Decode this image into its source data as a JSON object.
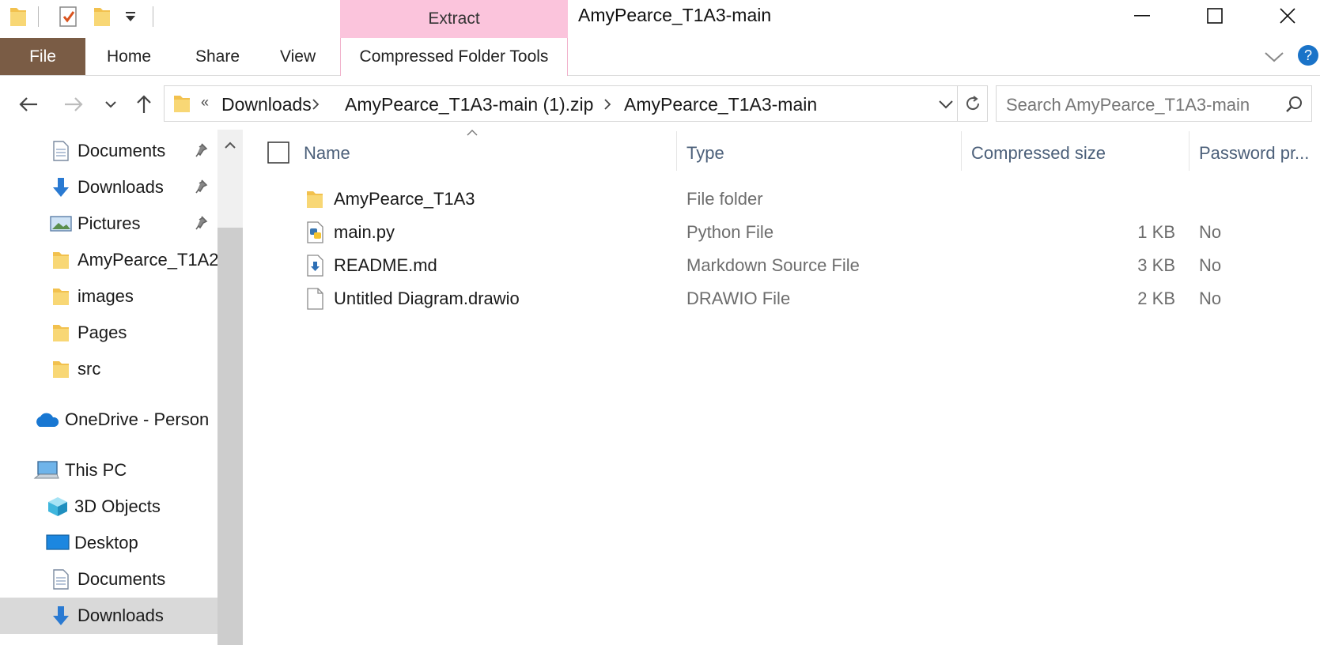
{
  "window": {
    "title": "AmyPearce_T1A3-main",
    "context_group": "Extract"
  },
  "ribbon": {
    "tabs": [
      "File",
      "Home",
      "Share",
      "View",
      "Compressed Folder Tools"
    ]
  },
  "address": {
    "overflow": "«",
    "crumbs": [
      "Downloads",
      "AmyPearce_T1A3-main (1).zip",
      "AmyPearce_T1A3-main"
    ]
  },
  "search": {
    "placeholder": "Search AmyPearce_T1A3-main"
  },
  "nav_pane": {
    "items": [
      {
        "label": "Documents",
        "icon": "document-icon"
      },
      {
        "label": "Downloads",
        "icon": "download-arrow-icon"
      },
      {
        "label": "Pictures",
        "icon": "pictures-icon"
      },
      {
        "label": "AmyPearce_T1A2",
        "icon": "folder-icon"
      },
      {
        "label": "images",
        "icon": "folder-icon"
      },
      {
        "label": "Pages",
        "icon": "folder-icon"
      },
      {
        "label": "src",
        "icon": "folder-icon"
      },
      {
        "label": "OneDrive - Person",
        "icon": "onedrive-cloud-icon"
      },
      {
        "label": "This PC",
        "icon": "this-pc-icon"
      },
      {
        "label": "3D Objects",
        "icon": "3d-objects-icon"
      },
      {
        "label": "Desktop",
        "icon": "desktop-icon"
      },
      {
        "label": "Documents",
        "icon": "document-icon"
      },
      {
        "label": "Downloads",
        "icon": "download-arrow-icon"
      }
    ]
  },
  "columns": {
    "name": "Name",
    "type": "Type",
    "compressed_size": "Compressed size",
    "password": "Password pr..."
  },
  "files": [
    {
      "name": "AmyPearce_T1A3",
      "type": "File folder",
      "size": "",
      "password": "",
      "icon": "folder-icon"
    },
    {
      "name": "main.py",
      "type": "Python File",
      "size": "1 KB",
      "password": "No",
      "icon": "python-file-icon"
    },
    {
      "name": "README.md",
      "type": "Markdown Source File",
      "size": "3 KB",
      "password": "No",
      "icon": "markdown-file-icon"
    },
    {
      "name": "Untitled Diagram.drawio",
      "type": "DRAWIO File",
      "size": "2 KB",
      "password": "No",
      "icon": "blank-file-icon"
    }
  ],
  "colors": {
    "file_tab": "#7a5c45",
    "context_tab": "#fbc4dc",
    "header_text": "#4c607a",
    "help_icon": "#1a73c8"
  }
}
